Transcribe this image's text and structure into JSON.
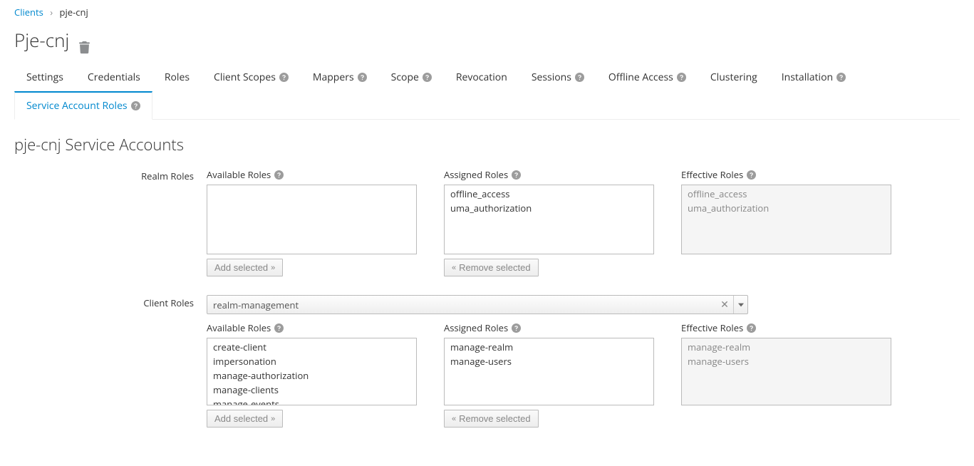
{
  "breadcrumb": {
    "parent": "Clients",
    "current": "pje-cnj"
  },
  "page_title": "Pje-cnj",
  "tabs": [
    {
      "label": "Settings",
      "help": false
    },
    {
      "label": "Credentials",
      "help": false
    },
    {
      "label": "Roles",
      "help": false
    },
    {
      "label": "Client Scopes",
      "help": true
    },
    {
      "label": "Mappers",
      "help": true
    },
    {
      "label": "Scope",
      "help": true
    },
    {
      "label": "Revocation",
      "help": false
    },
    {
      "label": "Sessions",
      "help": true
    },
    {
      "label": "Offline Access",
      "help": true
    },
    {
      "label": "Clustering",
      "help": false
    },
    {
      "label": "Installation",
      "help": true
    },
    {
      "label": "Service Account Roles",
      "help": true
    }
  ],
  "active_tab": "Service Account Roles",
  "section_title": "pje-cnj Service Accounts",
  "realm_roles": {
    "row_label": "Realm Roles",
    "available_label": "Available Roles",
    "assigned_label": "Assigned Roles",
    "effective_label": "Effective Roles",
    "available": [],
    "assigned": [
      "offline_access",
      "uma_authorization"
    ],
    "effective": [
      "offline_access",
      "uma_authorization"
    ],
    "add_btn": "Add selected",
    "remove_btn": "Remove selected"
  },
  "client_roles": {
    "row_label": "Client Roles",
    "selected_client": "realm-management",
    "available_label": "Available Roles",
    "assigned_label": "Assigned Roles",
    "effective_label": "Effective Roles",
    "available": [
      "create-client",
      "impersonation",
      "manage-authorization",
      "manage-clients",
      "manage-events"
    ],
    "assigned": [
      "manage-realm",
      "manage-users"
    ],
    "effective": [
      "manage-realm",
      "manage-users"
    ],
    "add_btn": "Add selected",
    "remove_btn": "Remove selected"
  }
}
